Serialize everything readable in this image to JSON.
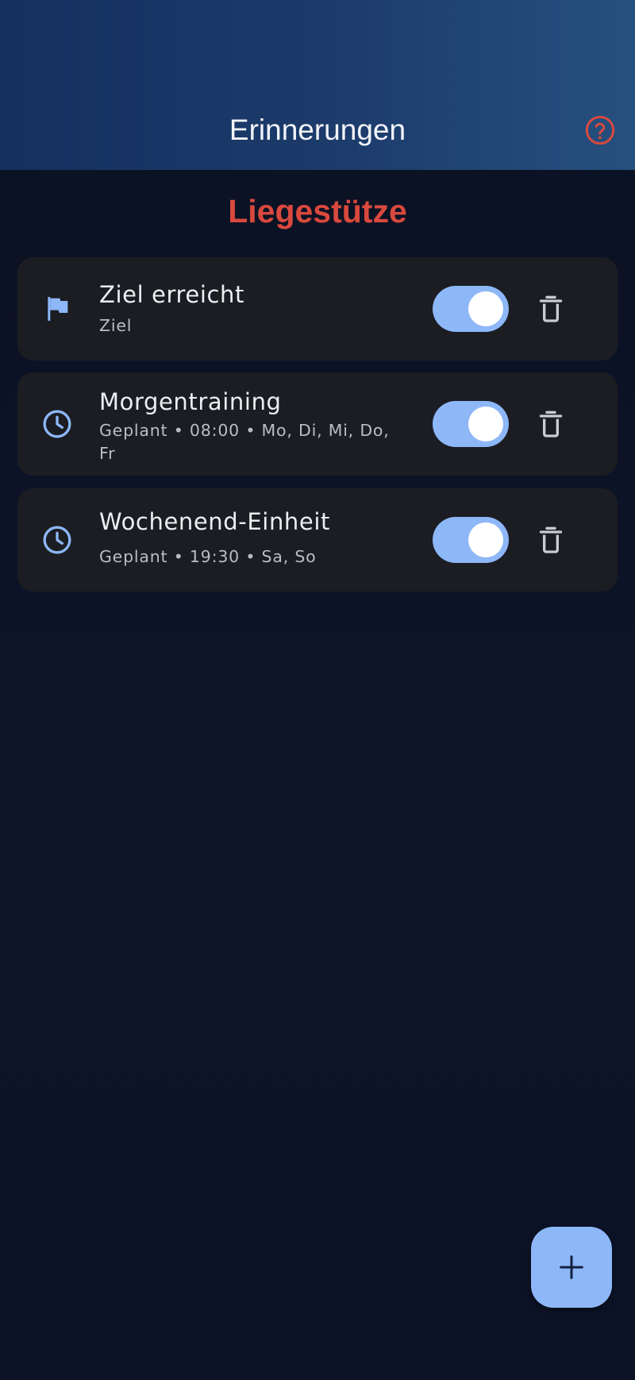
{
  "header": {
    "title": "Erinnerungen",
    "help_icon": "help-circle-icon"
  },
  "section": {
    "title": "Liegestütze"
  },
  "reminders": [
    {
      "icon": "flag-icon",
      "title": "Ziel erreicht",
      "subtitle": "Ziel",
      "enabled": true
    },
    {
      "icon": "clock-icon",
      "title": "Morgentraining",
      "subtitle": "Geplant • 08:00 • Mo, Di, Mi, Do, Fr",
      "enabled": true
    },
    {
      "icon": "clock-icon",
      "title": "Wochenend-Einheit",
      "subtitle": "Geplant • 19:30 • Sa, So",
      "enabled": true
    }
  ],
  "fab": {
    "icon": "plus-icon"
  },
  "colors": {
    "accent": "#8db7f7",
    "title_red": "#d9493d",
    "card_bg": "#1b1d22",
    "background": "#0c1224"
  }
}
